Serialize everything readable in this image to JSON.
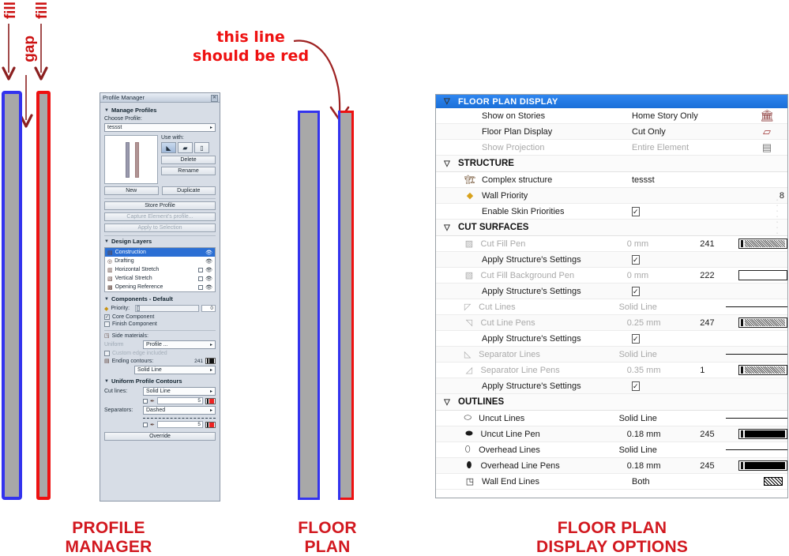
{
  "annotations": {
    "fill_left": "fill",
    "fill_right": "fill",
    "gap": "gap",
    "note_line1": "this line",
    "note_line2": "should be red"
  },
  "captions": {
    "profile_manager_line1": "PROFILE",
    "profile_manager_line2": "MANAGER",
    "floor_plan_line1": "FLOOR",
    "floor_plan_line2": "PLAN",
    "fpdo_line1": "FLOOR PLAN",
    "fpdo_line2": "DISPLAY OPTIONS"
  },
  "colors": {
    "annotation_red": "#ee1111",
    "caption_red": "#d2181f",
    "wall_blue": "#3333ee",
    "wall_red": "#ee1111",
    "wall_fill_gray": "#a8a8a8",
    "header_blue": "#1a6fd8"
  },
  "profile_manager": {
    "title": "Profile Manager",
    "close_icon": "close-icon",
    "section_manage": "Manage Profiles",
    "choose_profile_label": "Choose Profile:",
    "profile_value": "tessst",
    "use_with_label": "Use with:",
    "use_with_icons": [
      "wall-icon",
      "beam-icon",
      "column-icon"
    ],
    "buttons": {
      "delete": "Delete",
      "rename": "Rename",
      "new": "New",
      "duplicate": "Duplicate",
      "store_profile": "Store Profile",
      "capture": "Capture Element's profile...",
      "apply_to_selection": "Apply to Selection",
      "override": "Override"
    },
    "design_layers_label": "Design Layers",
    "design_layers": [
      {
        "name": "Construction",
        "selected": true,
        "has_checkbox": false,
        "eye": true
      },
      {
        "name": "Drafting",
        "selected": false,
        "has_checkbox": false,
        "eye": true
      },
      {
        "name": "Horizontal Stretch",
        "selected": false,
        "has_checkbox": true,
        "eye": true
      },
      {
        "name": "Vertical Stretch",
        "selected": false,
        "has_checkbox": true,
        "eye": true
      },
      {
        "name": "Opening Reference",
        "selected": false,
        "has_checkbox": true,
        "eye": true
      }
    ],
    "components_label": "Components - Default",
    "priority_label": "Priority:",
    "priority_value": "0",
    "core_component": "Core Component",
    "core_component_checked": true,
    "finish_component": "Finish Component",
    "finish_component_checked": false,
    "side_materials_label": "Side materials:",
    "uniform_label": "Uniform",
    "uniform_value": "Profile ...",
    "custom_edge_label": "Custom edge included",
    "ending_contours_label": "Ending contours:",
    "ending_contours_pen": "241",
    "ending_contours_line": "Solid Line",
    "uniform_contours_label": "Uniform Profile Contours",
    "cut_lines_label": "Cut lines:",
    "cut_lines_value": "Solid Line",
    "cut_lines_pen": "5",
    "separators_label": "Separators:",
    "separators_value": "Dashed",
    "separators_pen": "5"
  },
  "floor_plan_display_options": {
    "header": "FLOOR PLAN DISPLAY",
    "header_icon": "collapse-triangle-icon",
    "rows": [
      {
        "kind": "row",
        "icon": "",
        "label": "Show on Stories",
        "value": "Home Story Only",
        "num": "",
        "dim": false,
        "right": "stories-icon"
      },
      {
        "kind": "row",
        "icon": "",
        "label": "Floor Plan Display",
        "value": "Cut Only",
        "num": "",
        "dim": false,
        "right": "cut-only-icon"
      },
      {
        "kind": "row",
        "icon": "",
        "label": "Show Projection",
        "value": "Entire Element",
        "num": "",
        "dim": true,
        "right": "projection-icon"
      },
      {
        "kind": "group",
        "label": "STRUCTURE"
      },
      {
        "kind": "row",
        "icon": "complex-structure-icon",
        "label": "Complex structure",
        "value": "tessst",
        "num": "",
        "dim": false,
        "right": ""
      },
      {
        "kind": "priority",
        "icon": "priority-icon",
        "label": "Wall Priority",
        "value": "8"
      },
      {
        "kind": "check",
        "icon": "",
        "label": "Enable Skin Priorities",
        "checked": true
      },
      {
        "kind": "group",
        "label": "CUT SURFACES"
      },
      {
        "kind": "pen",
        "icon": "cut-fill-pen-icon",
        "label": "Cut Fill Pen",
        "value": "0 mm",
        "num": "241",
        "dim": true,
        "swatch": "hatch"
      },
      {
        "kind": "check",
        "icon": "",
        "label": "Apply Structure's Settings",
        "checked": true
      },
      {
        "kind": "pen",
        "icon": "cut-fill-background-pen-icon",
        "label": "Cut Fill Background Pen",
        "value": "0 mm",
        "num": "222",
        "dim": true,
        "swatch": "empty"
      },
      {
        "kind": "check",
        "icon": "",
        "label": "Apply Structure's Settings",
        "checked": true
      },
      {
        "kind": "line",
        "icon": "cut-lines-icon",
        "label": "Cut Lines",
        "value": "Solid Line",
        "num": "",
        "dim": true
      },
      {
        "kind": "pen",
        "icon": "cut-line-pens-icon",
        "label": "Cut Line Pens",
        "value": "0.25 mm",
        "num": "247",
        "dim": true,
        "swatch": "hatch"
      },
      {
        "kind": "check",
        "icon": "",
        "label": "Apply Structure's Settings",
        "checked": true
      },
      {
        "kind": "line",
        "icon": "separator-lines-icon",
        "label": "Separator Lines",
        "value": "Solid Line",
        "num": "",
        "dim": true
      },
      {
        "kind": "pen",
        "icon": "separator-line-pens-icon",
        "label": "Separator Line Pens",
        "value": "0.35 mm",
        "num": "1",
        "dim": true,
        "swatch": "hatch"
      },
      {
        "kind": "check",
        "icon": "",
        "label": "Apply Structure's Settings",
        "checked": true
      },
      {
        "kind": "group",
        "label": "OUTLINES"
      },
      {
        "kind": "line",
        "icon": "uncut-lines-icon",
        "label": "Uncut Lines",
        "value": "Solid Line",
        "num": "",
        "dim": false
      },
      {
        "kind": "pen",
        "icon": "uncut-line-pen-icon",
        "label": "Uncut Line Pen",
        "value": "0.18 mm",
        "num": "245",
        "dim": false,
        "swatch": "black"
      },
      {
        "kind": "line",
        "icon": "overhead-lines-icon",
        "label": "Overhead Lines",
        "value": "Solid Line",
        "num": "",
        "dim": false
      },
      {
        "kind": "pen",
        "icon": "overhead-line-pens-icon",
        "label": "Overhead Line Pens",
        "value": "0.18 mm",
        "num": "245",
        "dim": false,
        "swatch": "black"
      },
      {
        "kind": "wallend",
        "icon": "wall-end-lines-icon",
        "label": "Wall End Lines",
        "value": "Both",
        "num": "",
        "dim": false
      }
    ]
  }
}
